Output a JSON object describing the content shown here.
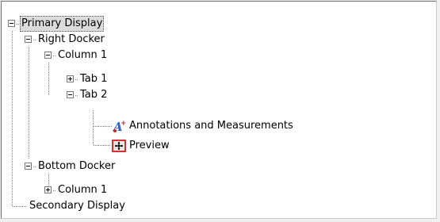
{
  "tree": {
    "nodes": [
      {
        "label": "Primary Display",
        "state": "expanded",
        "selected": true
      },
      {
        "label": "Right Docker",
        "state": "expanded"
      },
      {
        "label": "Column 1",
        "state": "expanded"
      },
      {
        "label": "Tab 1",
        "state": "collapsed"
      },
      {
        "label": "Tab 2",
        "state": "expanded"
      },
      {
        "label": "Annotations and Measurements",
        "icon": "annotation-icon"
      },
      {
        "label": "Preview",
        "icon": "move-cross-icon"
      },
      {
        "label": "Bottom Docker",
        "state": "expanded"
      },
      {
        "label": "Column 1",
        "state": "collapsed"
      },
      {
        "label": "Secondary Display"
      }
    ]
  },
  "colors": {
    "selection": "#dcdcdc",
    "annotation_icon": "#2f5fc4",
    "annotation_plus": "#e02020",
    "preview_border": "#d93030"
  }
}
